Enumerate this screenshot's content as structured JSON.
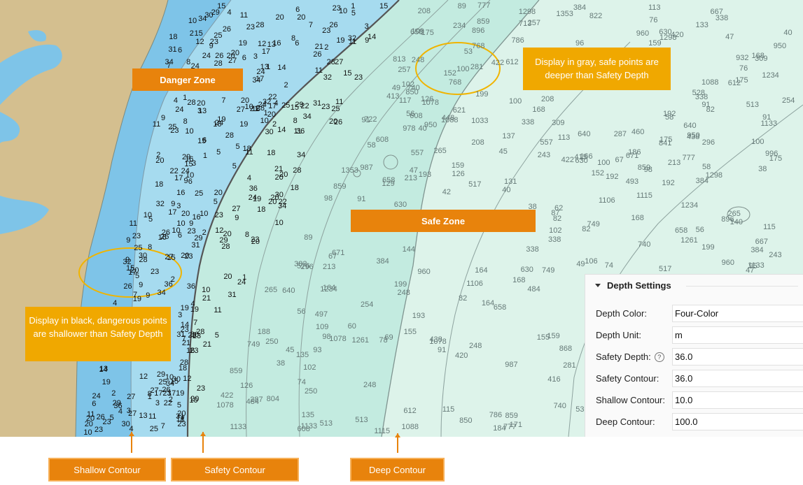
{
  "colors": {
    "land": "#d5bf8e",
    "water_shallow": "#7bc2e6",
    "water_mid": "#a9dcee",
    "water_safe": "#bfe9df",
    "water_deep": "#ddf3ea",
    "contour_safety": "#555555",
    "label_orange": "#e8830c",
    "callout_amber": "#f0a800"
  },
  "zones": {
    "danger": "Danger Zone",
    "safe": "Safe Zone"
  },
  "callouts": {
    "gray": "Display in gray, safe points are deeper than Safety Depth",
    "black": "Display in black, dangerous points are shallower than Safety Depth"
  },
  "legend": {
    "shallow": "Shallow Contour",
    "safety": "Safety Contour",
    "deep": "Deep Contour"
  },
  "panel": {
    "title": "Depth Settings",
    "rows": [
      {
        "label": "Depth Color:",
        "value": "Four-Color"
      },
      {
        "label": "Depth Unit:",
        "value": "m"
      },
      {
        "label": "Safety Depth:",
        "value": "36.0",
        "help_icon": "question-circle-icon"
      },
      {
        "label": "Safety Contour:",
        "value": "36.0"
      },
      {
        "label": "Shallow Contour:",
        "value": "10.0"
      },
      {
        "label": "Deep Contour:",
        "value": "100.0"
      }
    ]
  },
  "soundings": {
    "dark": [
      "10",
      "13",
      "19",
      "20",
      "23",
      "25",
      "31",
      "7",
      "16",
      "21",
      "29",
      "24",
      "11",
      "12",
      "17",
      "20",
      "23",
      "26",
      "27",
      "14",
      "18",
      "32",
      "15",
      "22",
      "28",
      "30",
      "34",
      "36",
      "9",
      "6",
      "8",
      "4",
      "5",
      "2",
      "3",
      "1"
    ],
    "gray": [
      "38",
      "40",
      "42",
      "45",
      "47",
      "49",
      "51",
      "53",
      "56",
      "58",
      "60",
      "62",
      "64",
      "67",
      "69",
      "71",
      "74",
      "76",
      "78",
      "80",
      "82",
      "84",
      "87",
      "89",
      "91",
      "93",
      "95",
      "96",
      "98",
      "100",
      "102",
      "104",
      "106",
      "107",
      "109",
      "113",
      "115",
      "117",
      "118",
      "120",
      "124",
      "126",
      "129",
      "131",
      "133",
      "135",
      "137",
      "140",
      "144",
      "148",
      "152",
      "155",
      "159",
      "164",
      "166",
      "168",
      "171",
      "175",
      "177",
      "184",
      "186",
      "188",
      "192",
      "193",
      "199",
      "208",
      "213",
      "234",
      "243",
      "248",
      "250",
      "254",
      "257",
      "265",
      "281",
      "287",
      "296",
      "309",
      "316",
      "320",
      "323",
      "338",
      "382",
      "384",
      "413",
      "415",
      "416",
      "420",
      "422",
      "429",
      "438",
      "448",
      "460",
      "466",
      "484",
      "493",
      "497",
      "502",
      "512",
      "513",
      "517",
      "528",
      "557",
      "566",
      "576",
      "603",
      "608",
      "612",
      "621",
      "630",
      "640",
      "658",
      "667",
      "671",
      "676",
      "713",
      "722",
      "740",
      "749",
      "768",
      "777",
      "786",
      "804",
      "813",
      "822",
      "841",
      "850",
      "859",
      "868",
      "886",
      "896",
      "932",
      "950",
      "960",
      "978",
      "987",
      "996",
      "1014",
      "1033",
      "1042",
      "1051",
      "1078",
      "1088",
      "1106",
      "1115",
      "1124",
      "1133",
      "1170",
      "1234",
      "1261",
      "1280",
      "1298",
      "1353"
    ]
  }
}
